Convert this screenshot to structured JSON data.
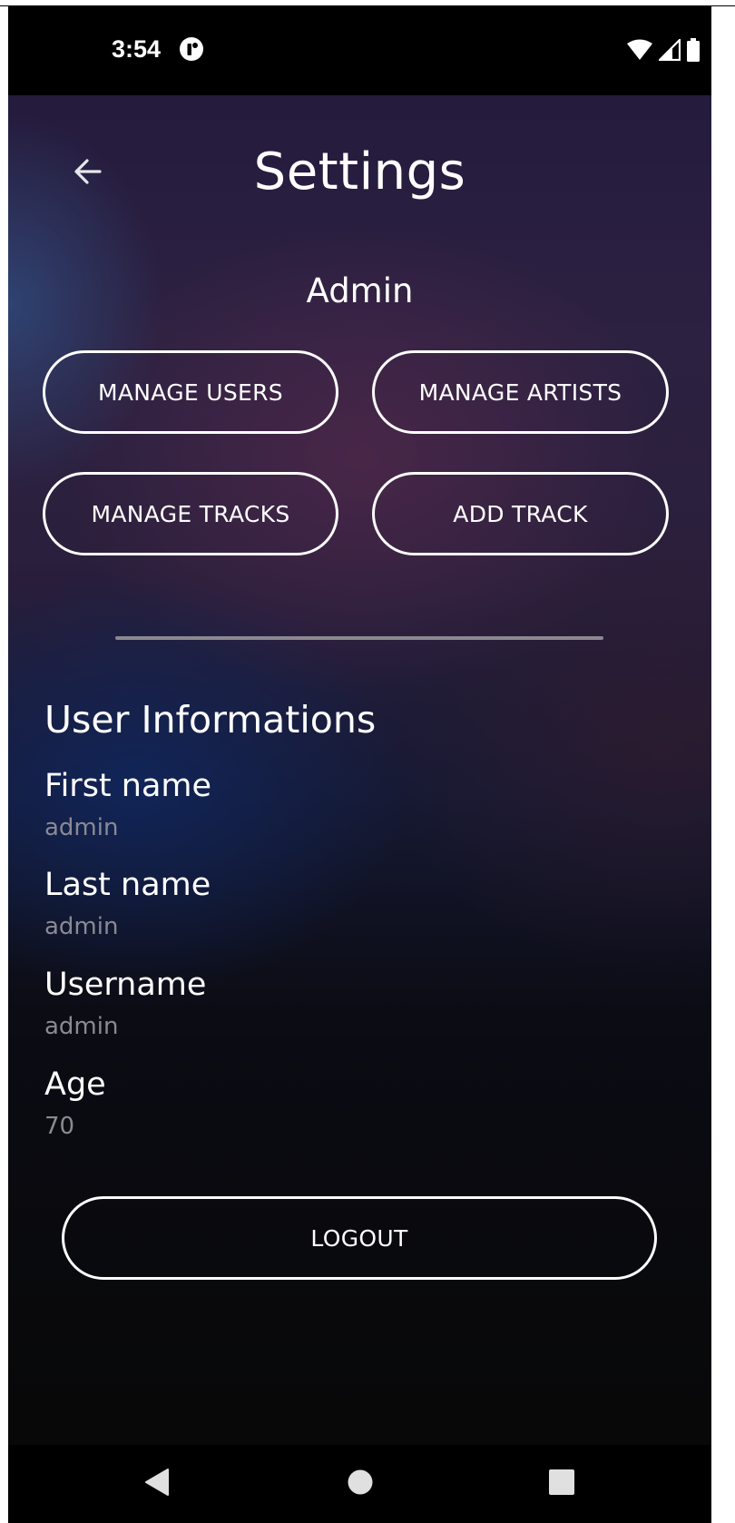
{
  "status_bar": {
    "time": "3:54",
    "icons": [
      "app-notification-icon",
      "wifi-icon",
      "cell-signal-icon",
      "battery-icon"
    ]
  },
  "header": {
    "back_icon": "arrow-left-icon",
    "title": "Settings"
  },
  "admin": {
    "heading": "Admin",
    "buttons": {
      "manage_users": "MANAGE USERS",
      "manage_artists": "MANAGE ARTISTS",
      "manage_tracks": "MANAGE TRACKS",
      "add_track": "ADD TRACK"
    }
  },
  "user_info": {
    "heading": "User Informations",
    "fields": [
      {
        "label": "First name",
        "value": "admin"
      },
      {
        "label": "Last name",
        "value": "admin"
      },
      {
        "label": "Username",
        "value": "admin"
      },
      {
        "label": "Age",
        "value": "70"
      }
    ]
  },
  "logout_label": "LOGOUT",
  "nav_bar": {
    "icons": [
      "nav-back-icon",
      "nav-home-icon",
      "nav-recents-icon"
    ]
  },
  "colors": {
    "text_primary": "#ffffff",
    "text_secondary": "#8a8a92",
    "divider": "#8c8890",
    "background_dark": "#080808"
  }
}
